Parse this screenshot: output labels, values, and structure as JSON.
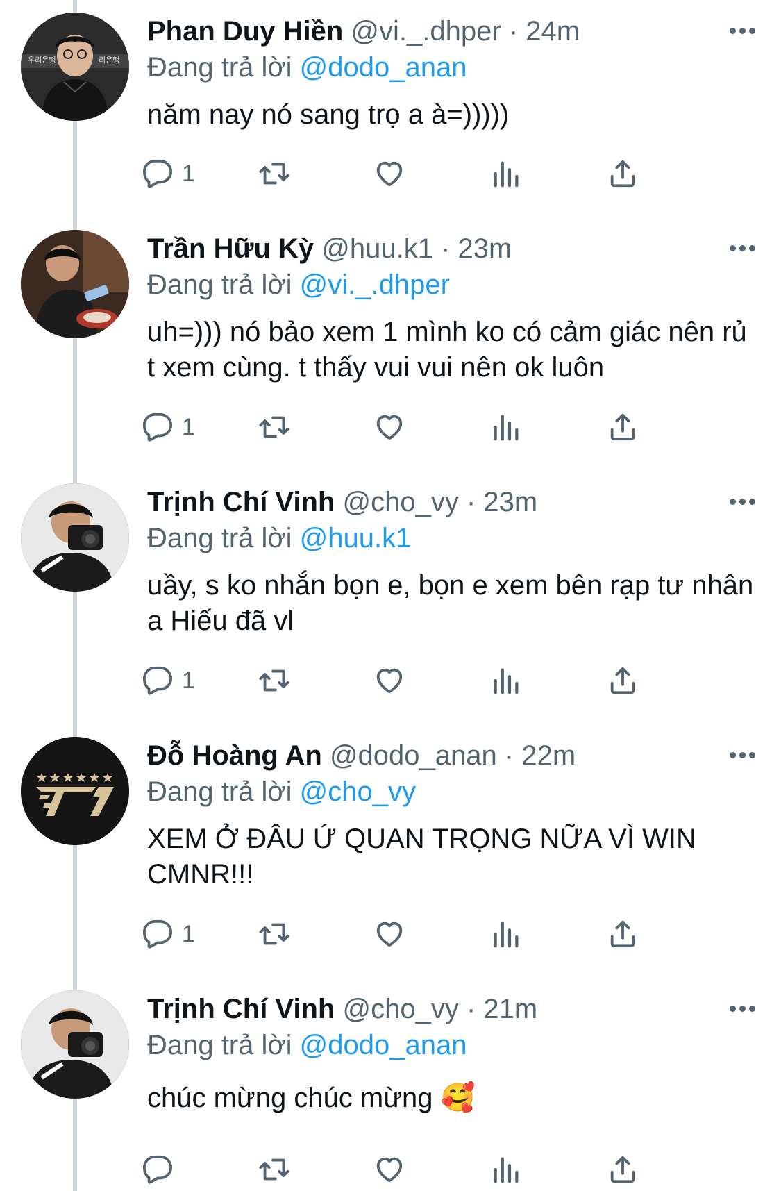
{
  "reply_prefix": "Đang trả lời",
  "tweets": [
    {
      "name": "Phan Duy Hiền",
      "handle": "@vi._.dhper",
      "sep": "·",
      "time": "24m",
      "reply_to": "@dodo_anan",
      "text": "năm nay nó sang trọ a à=)))))",
      "reply_count": "1",
      "avatar": "person-glasses-avatar"
    },
    {
      "name": "Trần Hữu Kỳ",
      "handle": "@huu.k1",
      "sep": "·",
      "time": "23m",
      "reply_to": "@vi._.dhper",
      "text": "uh=))) nó bảo xem 1 mình ko có cảm giác nên rủ t xem cùng. t thấy vui vui nên ok luôn",
      "reply_count": "1",
      "avatar": "person-phone-avatar"
    },
    {
      "name": "Trịnh Chí Vinh",
      "handle": "@cho_vy",
      "sep": "·",
      "time": "23m",
      "reply_to": "@huu.k1",
      "text": "uầy, s ko nhắn bọn e, bọn e xem bên rạp tư nhân a Hiếu đã vl",
      "reply_count": "1",
      "avatar": "person-camera-avatar"
    },
    {
      "name": "Đỗ Hoàng An",
      "handle": "@dodo_anan",
      "sep": "·",
      "time": "22m",
      "reply_to": "@cho_vy",
      "text": "XEM Ở ĐÂU Ứ QUAN TRỌNG NỮA VÌ WIN CMNR!!!",
      "reply_count": "1",
      "avatar": "t1-logo-avatar"
    },
    {
      "name": "Trịnh Chí Vinh",
      "handle": "@cho_vy",
      "sep": "·",
      "time": "21m",
      "reply_to": "@dodo_anan",
      "text": "chúc mừng chúc mừng 🥰",
      "reply_count": "",
      "avatar": "person-camera-avatar"
    }
  ],
  "colors": {
    "text": "#0f1419",
    "secondary": "#536471",
    "link": "#1d9bf0",
    "thread_line": "#d0d5d9"
  },
  "icons": [
    "reply-icon",
    "retweet-icon",
    "like-icon",
    "views-icon",
    "share-icon",
    "more-icon"
  ]
}
